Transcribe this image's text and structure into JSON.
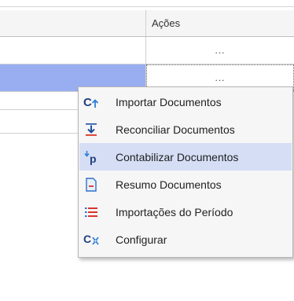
{
  "grid": {
    "header": {
      "actions_column": "Ações"
    },
    "rows": [
      {
        "actions": "...",
        "selected": false
      },
      {
        "actions": "...",
        "selected": true
      }
    ]
  },
  "context_menu": {
    "items": [
      {
        "label": "Importar Documentos",
        "icon": "import-documents-icon"
      },
      {
        "label": "Reconciliar Documentos",
        "icon": "reconcile-download-icon"
      },
      {
        "label": "Contabilizar Documentos",
        "icon": "post-accounting-icon",
        "highlighted": true
      },
      {
        "label": "Resumo Documentos",
        "icon": "summary-document-icon"
      },
      {
        "label": "Importações do Período",
        "icon": "list-icon"
      },
      {
        "label": "Configurar",
        "icon": "configure-icon"
      }
    ]
  },
  "colors": {
    "selection": "#99aef0",
    "menu_highlight": "#d5def5",
    "icon_blue": "#1f4e9e",
    "icon_red": "#d9342b"
  }
}
